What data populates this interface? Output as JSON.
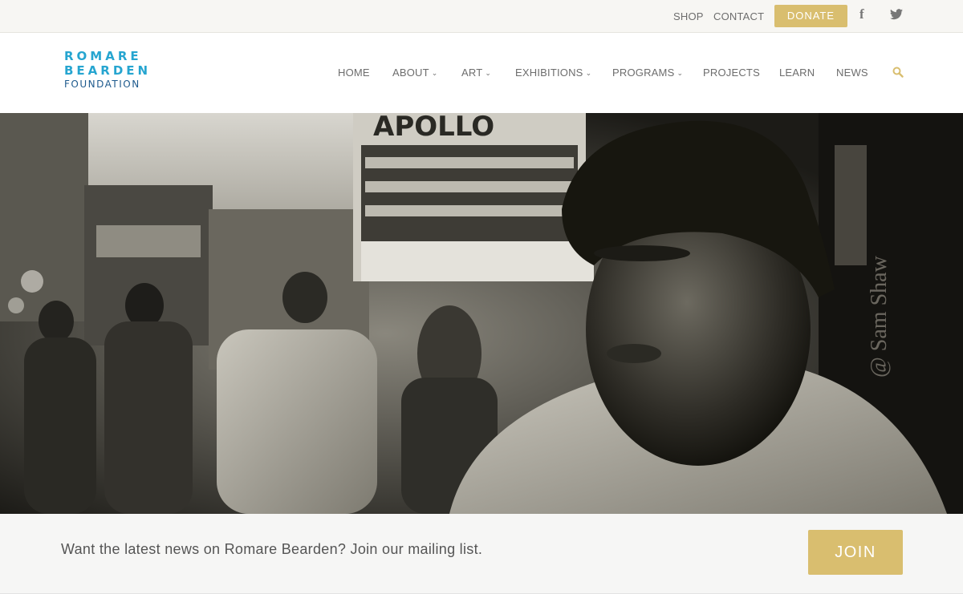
{
  "topbar": {
    "shop": "SHOP",
    "contact": "CONTACT",
    "donate": "DONATE",
    "social": [
      "facebook-icon",
      "twitter-icon"
    ]
  },
  "logo": {
    "line1": "ROMARE",
    "line2": "BEARDEN",
    "line3": "FOUNDATION"
  },
  "nav": {
    "items": [
      {
        "label": "HOME",
        "dropdown": false
      },
      {
        "label": "ABOUT",
        "dropdown": true
      },
      {
        "label": "ART",
        "dropdown": true
      },
      {
        "label": "EXHIBITIONS",
        "dropdown": true
      },
      {
        "label": "PROGRAMS",
        "dropdown": true
      },
      {
        "label": "PROJECTS",
        "dropdown": false
      },
      {
        "label": "LEARN",
        "dropdown": false
      },
      {
        "label": "NEWS",
        "dropdown": false
      }
    ],
    "search_icon": "search-icon"
  },
  "hero": {
    "sign_text": "APOLLO",
    "photo_credit": "@ Sam Shaw"
  },
  "newsletter": {
    "message": "Want the latest news on Romare Bearden? Join our mailing list.",
    "button": "JOIN"
  },
  "colors": {
    "accent_gold": "#d9be6f",
    "logo_blue": "#26a5d0",
    "logo_dark_blue": "#1e5a8d"
  }
}
